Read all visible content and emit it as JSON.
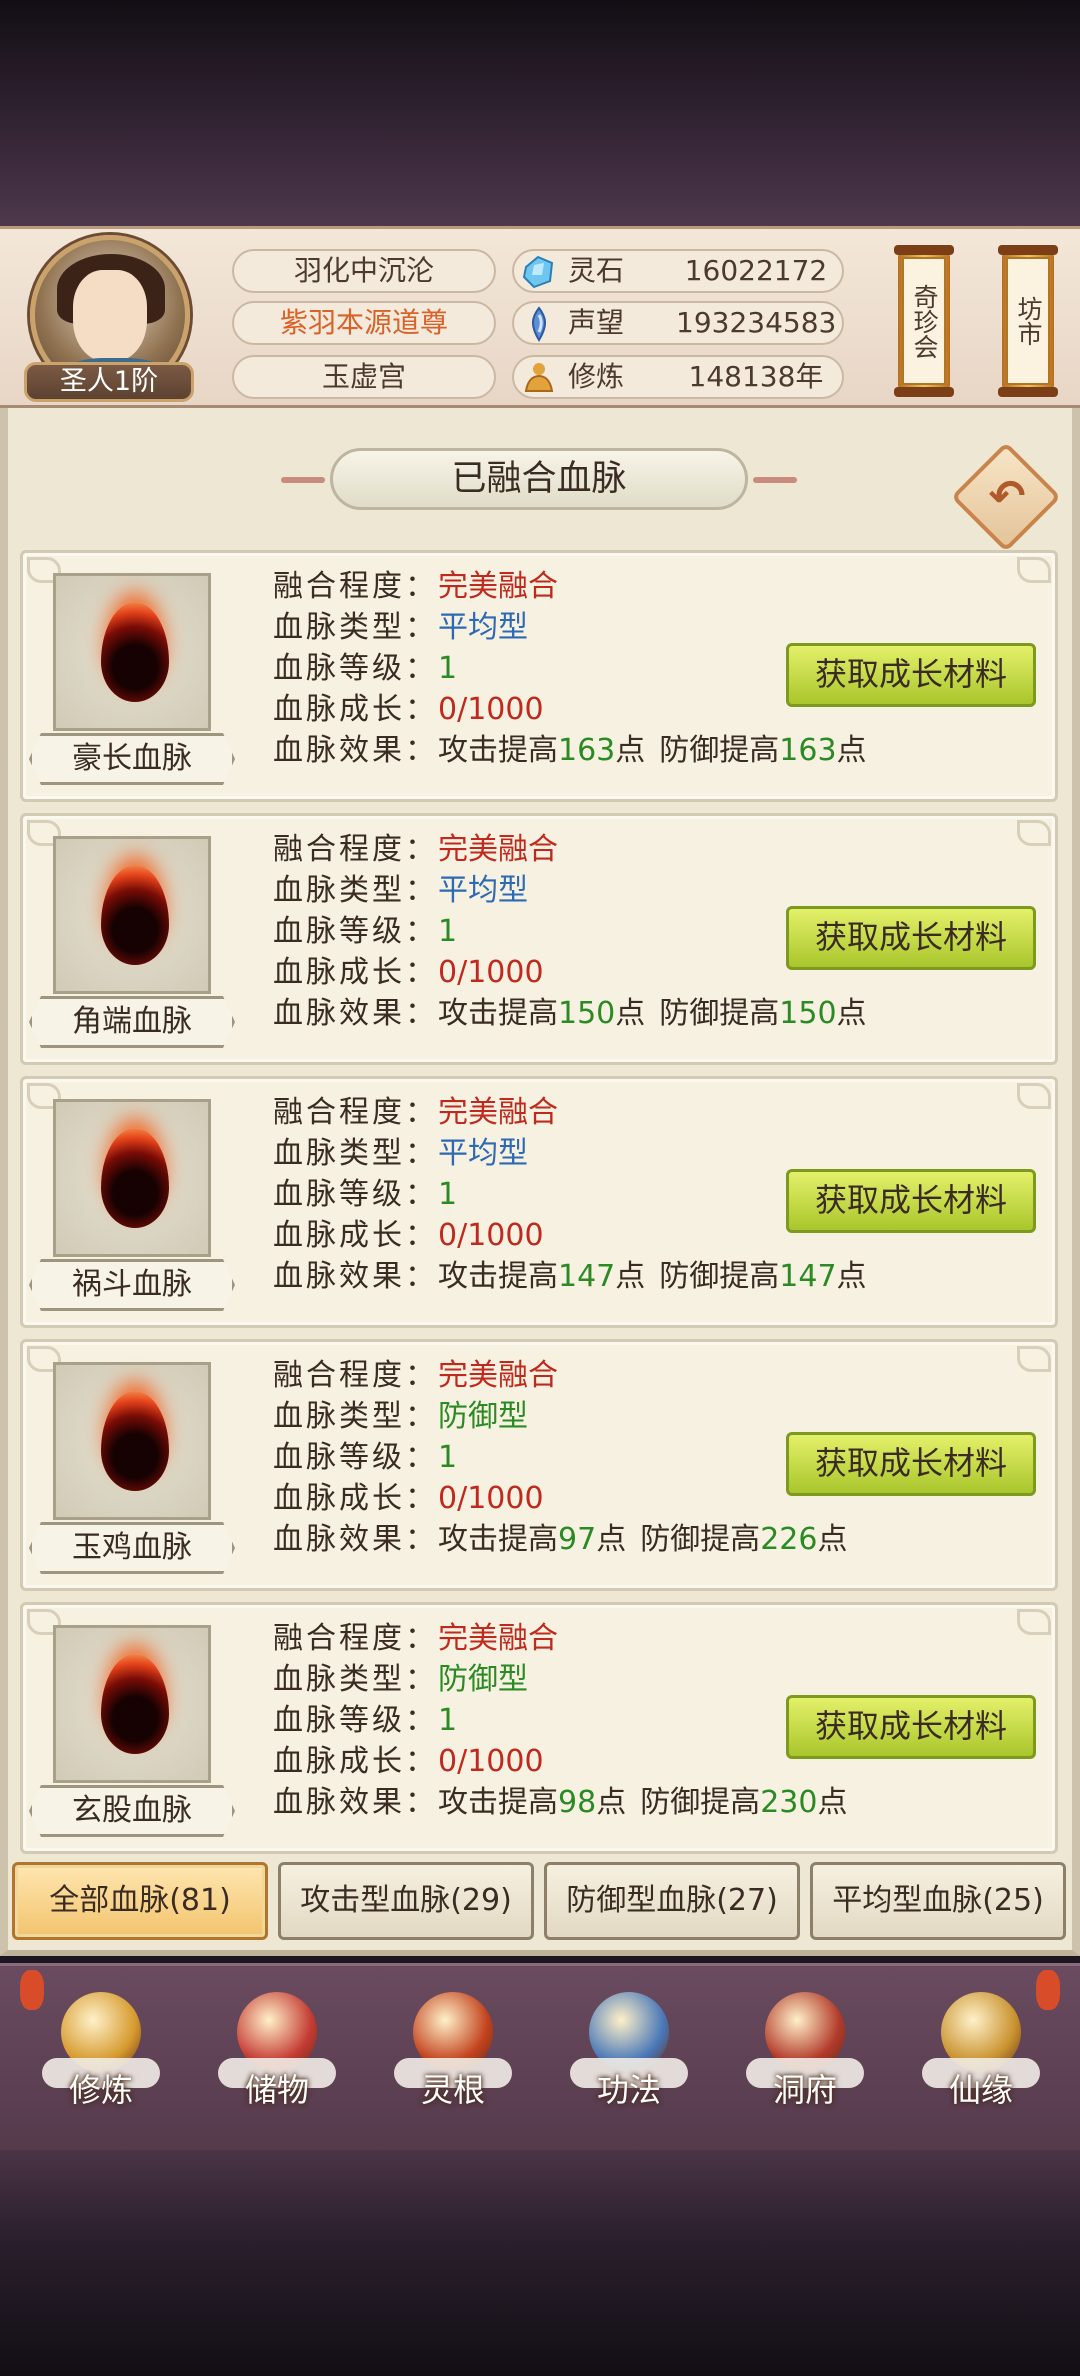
{
  "header": {
    "rank": "圣人1阶",
    "titles": [
      "羽化中沉沦",
      "紫羽本源道尊",
      "玉虚宫"
    ],
    "stats": [
      {
        "icon": "spirit-stone-icon",
        "label": "灵石",
        "value": "16022172"
      },
      {
        "icon": "reputation-icon",
        "label": "声望",
        "value": "193234583"
      },
      {
        "icon": "cultivation-icon",
        "label": "修炼",
        "value": "148138年"
      }
    ],
    "side_buttons": [
      "奇珍会",
      "坊市"
    ]
  },
  "panel": {
    "title": "已融合血脉"
  },
  "field_labels": {
    "fusion": "融合程度：",
    "type": "血脉类型：",
    "level": "血脉等级：",
    "growth": "血脉成长：",
    "effect": "血脉效果："
  },
  "effect_text": {
    "atk": "攻击提高",
    "def": "防御提高",
    "unit": "点"
  },
  "get_button_label": "获取成长材料",
  "bloodlines": [
    {
      "name": "豪长血脉",
      "fusion": "完美融合",
      "type": "平均型",
      "level": "1",
      "growth": "0/1000",
      "atk": "163",
      "def": "163"
    },
    {
      "name": "角端血脉",
      "fusion": "完美融合",
      "type": "平均型",
      "level": "1",
      "growth": "0/1000",
      "atk": "150",
      "def": "150"
    },
    {
      "name": "祸斗血脉",
      "fusion": "完美融合",
      "type": "平均型",
      "level": "1",
      "growth": "0/1000",
      "atk": "147",
      "def": "147"
    },
    {
      "name": "玉鸡血脉",
      "fusion": "完美融合",
      "type": "防御型",
      "level": "1",
      "growth": "0/1000",
      "atk": "97",
      "def": "226"
    },
    {
      "name": "玄股血脉",
      "fusion": "完美融合",
      "type": "防御型",
      "level": "1",
      "growth": "0/1000",
      "atk": "98",
      "def": "230"
    }
  ],
  "filter_tabs": [
    "全部血脉(81)",
    "攻击型血脉(29)",
    "防御型血脉(27)",
    "平均型血脉(25)"
  ],
  "bottom_nav": [
    {
      "label": "修炼",
      "icon": "cultivate-icon",
      "color": "#d69a2e"
    },
    {
      "label": "储物",
      "icon": "storage-bag-icon",
      "color": "#c43b33"
    },
    {
      "label": "灵根",
      "icon": "spirit-root-icon",
      "color": "#c2421d"
    },
    {
      "label": "功法",
      "icon": "technique-book-icon",
      "color": "#4a78b8"
    },
    {
      "label": "洞府",
      "icon": "cave-dwelling-icon",
      "color": "#b23a2a"
    },
    {
      "label": "仙缘",
      "icon": "destiny-gourd-icon",
      "color": "#c9922f"
    }
  ]
}
